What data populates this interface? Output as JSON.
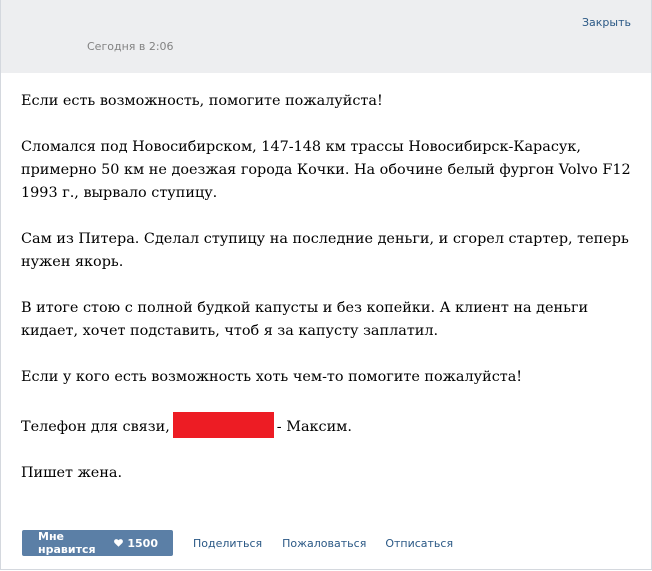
{
  "header": {
    "close_label": "Закрыть",
    "timestamp": "Сегодня в 2:06"
  },
  "post": {
    "paragraphs": [
      "Если есть возможность, помогите пожалуйста!",
      "Сломался под Новосибирском, 147-148 км трассы Новосибирск-Карасук, примерно 50 км не доезжая города Кочки. На обочине белый фургон Volvo F12 1993 г., вырвало ступицу.",
      "Сам из Питера. Сделал ступицу на последние деньги, и сгорел стартер, теперь нужен якорь.",
      "В итоге стою с полной будкой капусты и без копейки. А клиент на деньги кидает, хочет подставить, чтоб я за капусту заплатил.",
      "Если у кого есть возможность хоть чем-то помогите пожалуйста!"
    ],
    "phone_prefix": "Телефон для связи,",
    "phone_suffix": "- Максим.",
    "signature": "Пишет жена.",
    "redaction_color": "#ed1c24"
  },
  "footer": {
    "like_label": "Мне нравится",
    "like_icon": "heart-icon",
    "like_count": "1500",
    "share_label": "Поделиться",
    "report_label": "Пожаловаться",
    "unsubscribe_label": "Отписаться"
  },
  "colors": {
    "header_bg": "#edeef0",
    "link": "#2a5885",
    "like_button_bg": "#5b7fa6",
    "timestamp": "#828282"
  }
}
